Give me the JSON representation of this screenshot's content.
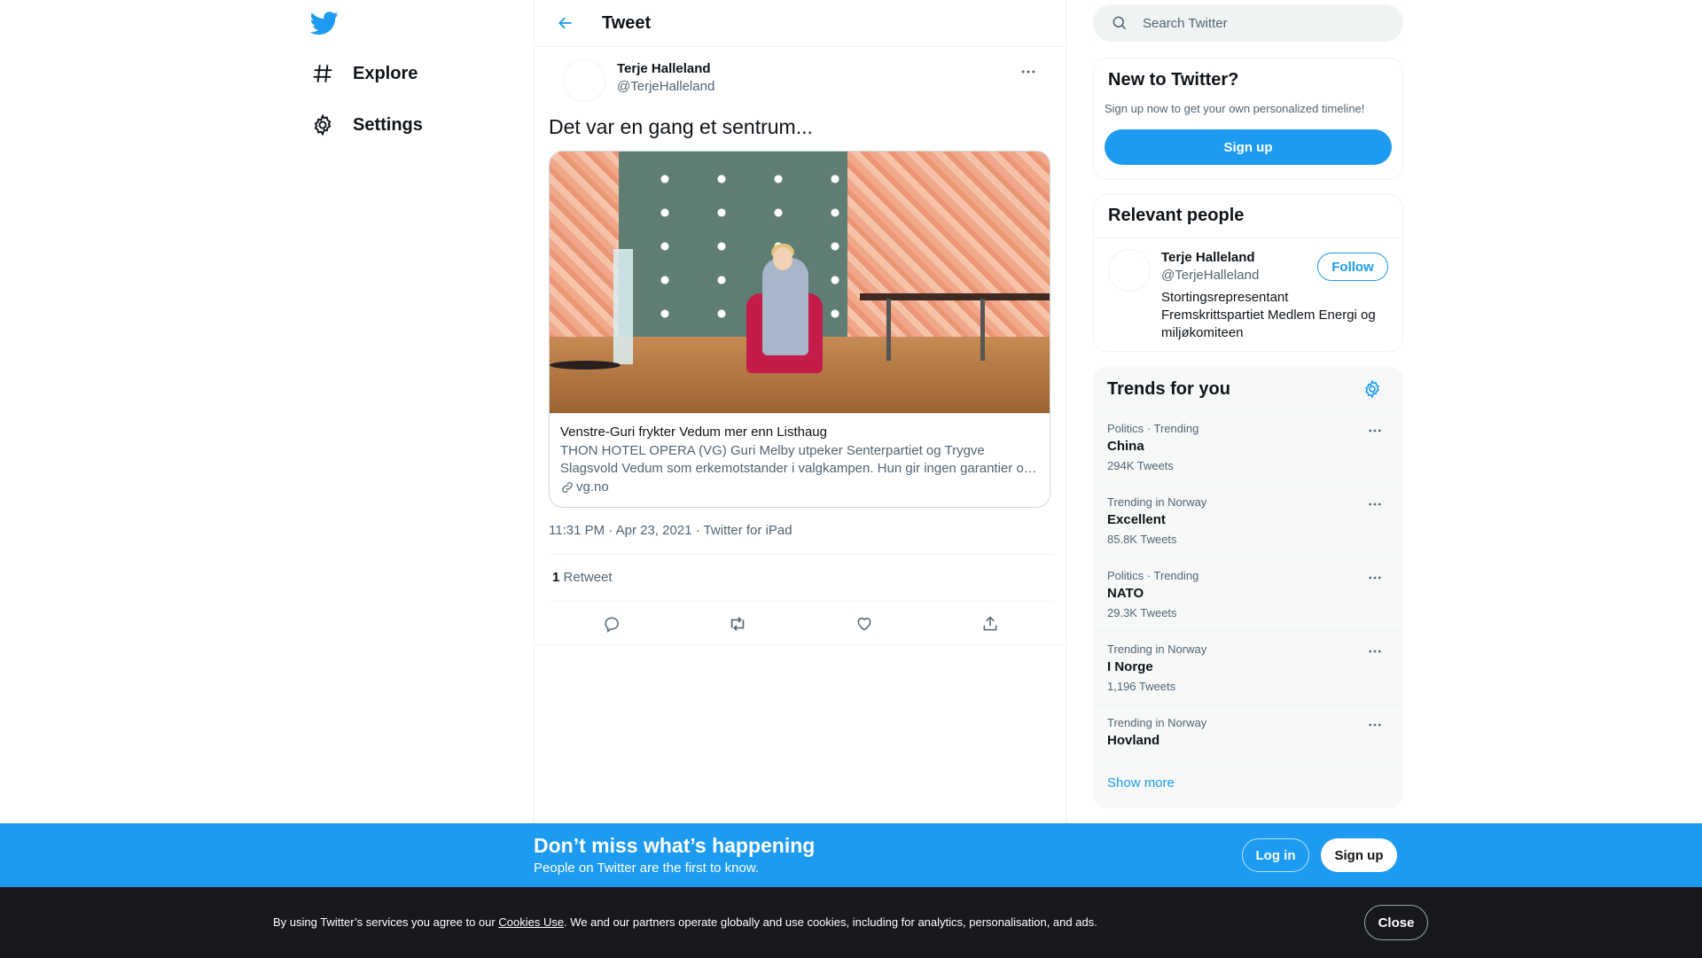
{
  "colors": {
    "accent": "#1d9bf0",
    "text": "#0f1419",
    "secondary": "#536471",
    "cookie_bg": "#16181c"
  },
  "nav": {
    "logo_icon": "twitter-bird-icon",
    "items": [
      {
        "label": "Explore",
        "icon": "hashtag-icon"
      },
      {
        "label": "Settings",
        "icon": "gear-icon"
      }
    ]
  },
  "header": {
    "title": "Tweet",
    "back_icon": "arrow-left-icon"
  },
  "tweet": {
    "author_name": "Terje Halleland",
    "author_handle": "@TerjeHalleland",
    "text": "Det var en gang et sentrum...",
    "card": {
      "title": "Venstre-Guri frykter Vedum mer enn Listhaug",
      "description": "THON HOTEL OPERA (VG) Guri Melby utpeker Senterpartiet og Trygve Slagsvold Vedum som erkemotstander i valgkampen. Hun gir ingen garantier om hvem hun vil støtte.",
      "domain": "vg.no"
    },
    "meta": "11:31 PM · Apr 23, 2021 · Twitter for iPad",
    "retweet_count": "1",
    "retweet_label": "Retweet",
    "actions": [
      "reply-icon",
      "retweet-icon",
      "like-icon",
      "share-icon"
    ]
  },
  "search": {
    "placeholder": "Search Twitter"
  },
  "new_to_twitter": {
    "title": "New to Twitter?",
    "subtitle": "Sign up now to get your own personalized timeline!",
    "signup_label": "Sign up"
  },
  "relevant_people": {
    "title": "Relevant people",
    "person": {
      "name": "Terje Halleland",
      "handle": "@TerjeHalleland",
      "bio": "Stortingsrepresentant Fremskrittspartiet Medlem Energi og miljøkomiteen",
      "follow_label": "Follow"
    }
  },
  "trends": {
    "title": "Trends for you",
    "items": [
      {
        "context": "Politics · Trending",
        "name": "China",
        "count": "294K Tweets"
      },
      {
        "context": "Trending in Norway",
        "name": "Excellent",
        "count": "85.8K Tweets"
      },
      {
        "context": "Politics · Trending",
        "name": "NATO",
        "count": "29.3K Tweets"
      },
      {
        "context": "Trending in Norway",
        "name": "I Norge",
        "count": "1,196 Tweets"
      },
      {
        "context": "Trending in Norway",
        "name": "Hovland",
        "count": ""
      }
    ],
    "show_more": "Show more"
  },
  "banner": {
    "title": "Don’t miss what’s happening",
    "subtitle": "People on Twitter are the first to know.",
    "login_label": "Log in",
    "signup_label": "Sign up"
  },
  "cookie": {
    "text_before": "By using Twitter’s services you agree to our ",
    "link": "Cookies Use",
    "text_after": ". We and our partners operate globally and use cookies, including for analytics, personalisation, and ads.",
    "close_label": "Close"
  }
}
